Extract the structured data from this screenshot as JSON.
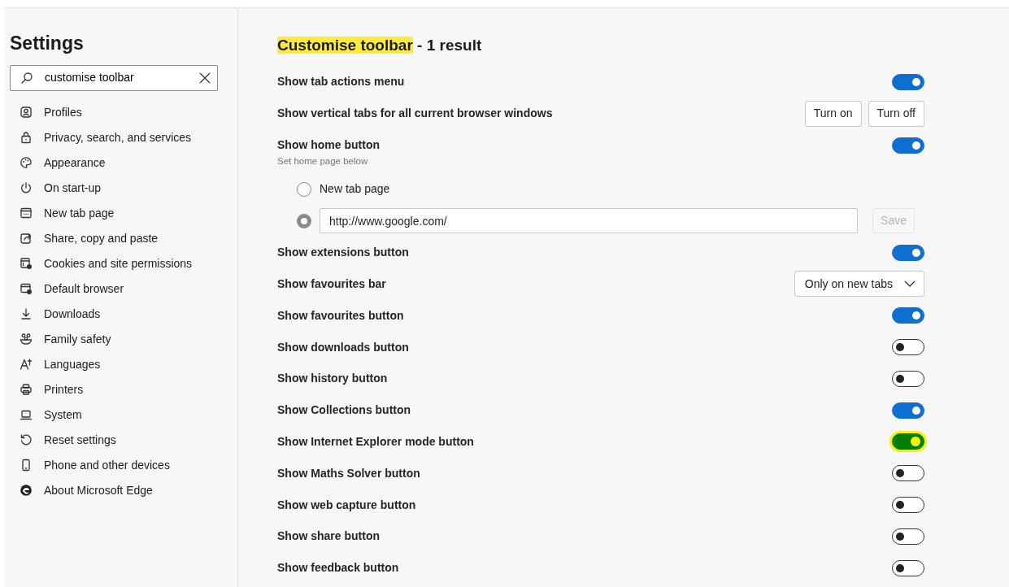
{
  "sidebar": {
    "title": "Settings",
    "search": {
      "value": "customise toolbar"
    },
    "items": [
      {
        "label": "Profiles"
      },
      {
        "label": "Privacy, search, and services"
      },
      {
        "label": "Appearance"
      },
      {
        "label": "On start-up"
      },
      {
        "label": "New tab page"
      },
      {
        "label": "Share, copy and paste"
      },
      {
        "label": "Cookies and site permissions"
      },
      {
        "label": "Default browser"
      },
      {
        "label": "Downloads"
      },
      {
        "label": "Family safety"
      },
      {
        "label": "Languages"
      },
      {
        "label": "Printers"
      },
      {
        "label": "System"
      },
      {
        "label": "Reset settings"
      },
      {
        "label": "Phone and other devices"
      },
      {
        "label": "About Microsoft Edge"
      }
    ]
  },
  "content": {
    "heading": {
      "match": "Customise toolbar",
      "rest": " - 1 result"
    },
    "rows": [
      {
        "kind": "toggle",
        "label": "Show tab actions menu",
        "on": true,
        "highlighted": false
      },
      {
        "kind": "buttons",
        "label": "Show vertical tabs for all current browser windows",
        "buttons": [
          "Turn on",
          "Turn off"
        ]
      },
      {
        "kind": "home",
        "label": "Show home button",
        "hint": "Set home page below",
        "on": true,
        "highlighted": false,
        "options": [
          {
            "label": "New tab page",
            "selected": false
          },
          {
            "value": "http://www.google.com/",
            "selected": true
          }
        ],
        "save": {
          "label": "Save",
          "disabled": true
        }
      },
      {
        "kind": "toggle",
        "label": "Show extensions button",
        "on": true,
        "highlighted": false
      },
      {
        "kind": "select",
        "label": "Show favourites bar",
        "value": "Only on new tabs"
      },
      {
        "kind": "toggle",
        "label": "Show favourites button",
        "on": true,
        "highlighted": false
      },
      {
        "kind": "toggle",
        "label": "Show downloads button",
        "on": false,
        "highlighted": false
      },
      {
        "kind": "toggle",
        "label": "Show history button",
        "on": false,
        "highlighted": false
      },
      {
        "kind": "toggle",
        "label": "Show Collections button",
        "on": true,
        "highlighted": false
      },
      {
        "kind": "toggle",
        "label": "Show Internet Explorer mode button",
        "on": true,
        "highlighted": true
      },
      {
        "kind": "toggle",
        "label": "Show Maths Solver button",
        "on": false,
        "highlighted": false
      },
      {
        "kind": "toggle",
        "label": "Show web capture button",
        "on": false,
        "highlighted": false
      },
      {
        "kind": "toggle",
        "label": "Show share button",
        "on": false,
        "highlighted": false
      },
      {
        "kind": "toggle",
        "label": "Show feedback button",
        "on": false,
        "highlighted": false
      }
    ]
  }
}
